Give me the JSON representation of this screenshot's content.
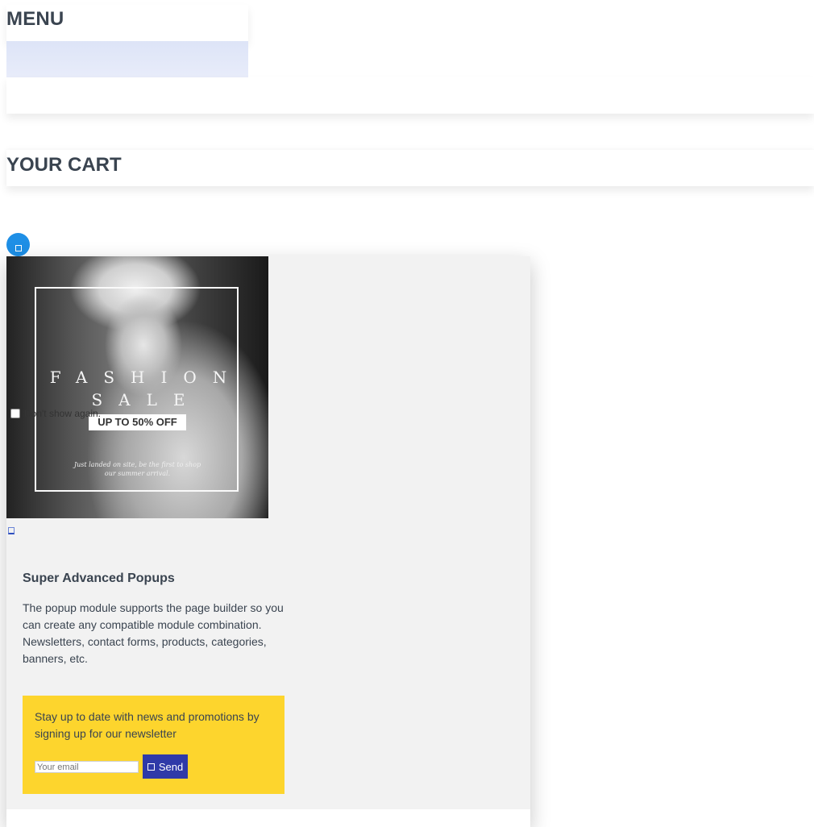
{
  "menu": {
    "title": "MENU"
  },
  "cart": {
    "title": "YOUR CART"
  },
  "popup": {
    "close_icon": "close-icon",
    "image": {
      "word1": "FASHION",
      "word2": "SALE",
      "badge": "UP TO 50% OFF",
      "small_text_line1": "Just landed on site, be the first to shop",
      "small_text_line2": "our summer arrival."
    },
    "dont_show_label": "Don't show again.",
    "heading": "Super Advanced Popups",
    "description": "The popup module supports the page builder so you can create any compatible module combination. Newsletters, contact forms, products, categories, banners, etc.",
    "newsletter": {
      "text": "Stay up to date with news and promotions by signing up for our newsletter",
      "email_placeholder": "Your email",
      "send_label": "Send",
      "background_color": "#fdd52d",
      "button_color": "#2f3aa8"
    }
  },
  "colors": {
    "accent_blue": "#1e8fe6",
    "text": "#3a4450",
    "popup_bg": "#f2f2f2"
  }
}
